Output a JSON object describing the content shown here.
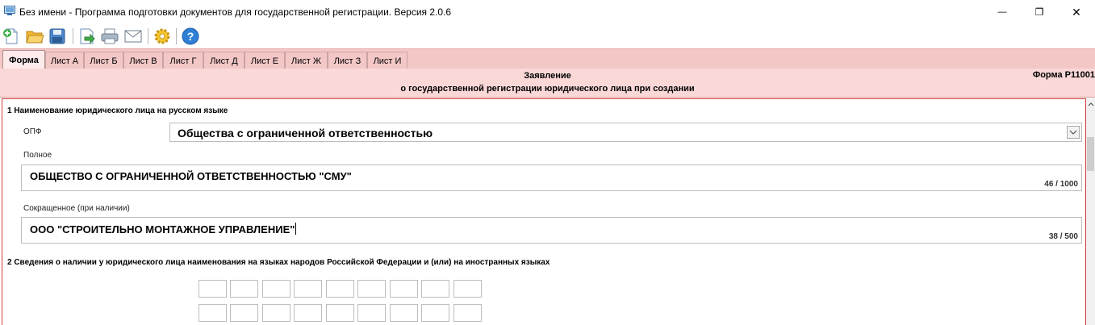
{
  "window": {
    "title": "Без имени - Программа подготовки документов для государственной регистрации. Версия 2.0.6",
    "minimize_glyph": "—",
    "maximize_glyph": "❐",
    "close_glyph": "✕"
  },
  "toolbar": {
    "buttons": [
      {
        "name": "new-document-icon"
      },
      {
        "name": "open-folder-icon"
      },
      {
        "name": "save-disk-icon"
      },
      {
        "name": "export-icon"
      },
      {
        "name": "print-icon"
      },
      {
        "name": "mail-icon"
      },
      {
        "name": "settings-gear-icon"
      },
      {
        "name": "help-icon"
      }
    ]
  },
  "tabs": [
    {
      "label": "Форма",
      "active": true
    },
    {
      "label": "Лист А",
      "active": false
    },
    {
      "label": "Лист Б",
      "active": false
    },
    {
      "label": "Лист В",
      "active": false
    },
    {
      "label": "Лист Г",
      "active": false
    },
    {
      "label": "Лист Д",
      "active": false
    },
    {
      "label": "Лист Е",
      "active": false
    },
    {
      "label": "Лист Ж",
      "active": false
    },
    {
      "label": "Лист З",
      "active": false
    },
    {
      "label": "Лист И",
      "active": false
    }
  ],
  "header": {
    "title_line1": "Заявление",
    "title_line2": "о государственной регистрации юридического лица при создании",
    "form_code": "Форма Р11001"
  },
  "section1": {
    "label": "1  Наименование юридического лица на русском языке",
    "opf_label": "ОПФ",
    "opf_value": "Общества с ограниченной ответственностью",
    "full_label": "Полное",
    "full_value": "ОБЩЕСТВО С ОГРАНИЧЕННОЙ ОТВЕТСТВЕННОСТЬЮ \"СМУ\"",
    "full_counter": "46 / 1000",
    "short_label": "Сокращенное (при наличии)",
    "short_value": "ООО \"СТРОИТЕЛЬНО МОНТАЖНОЕ УПРАВЛЕНИЕ\"",
    "short_counter": "38 / 500"
  },
  "section2": {
    "label": "2  Сведения о наличии у юридического лица наименования на языках народов Российской Федерации и (или) на иностранных языках"
  },
  "colors": {
    "tab_strip": "#f4c7c7",
    "header_bg": "#fbd8d8",
    "panel_border": "#d43a3a"
  }
}
